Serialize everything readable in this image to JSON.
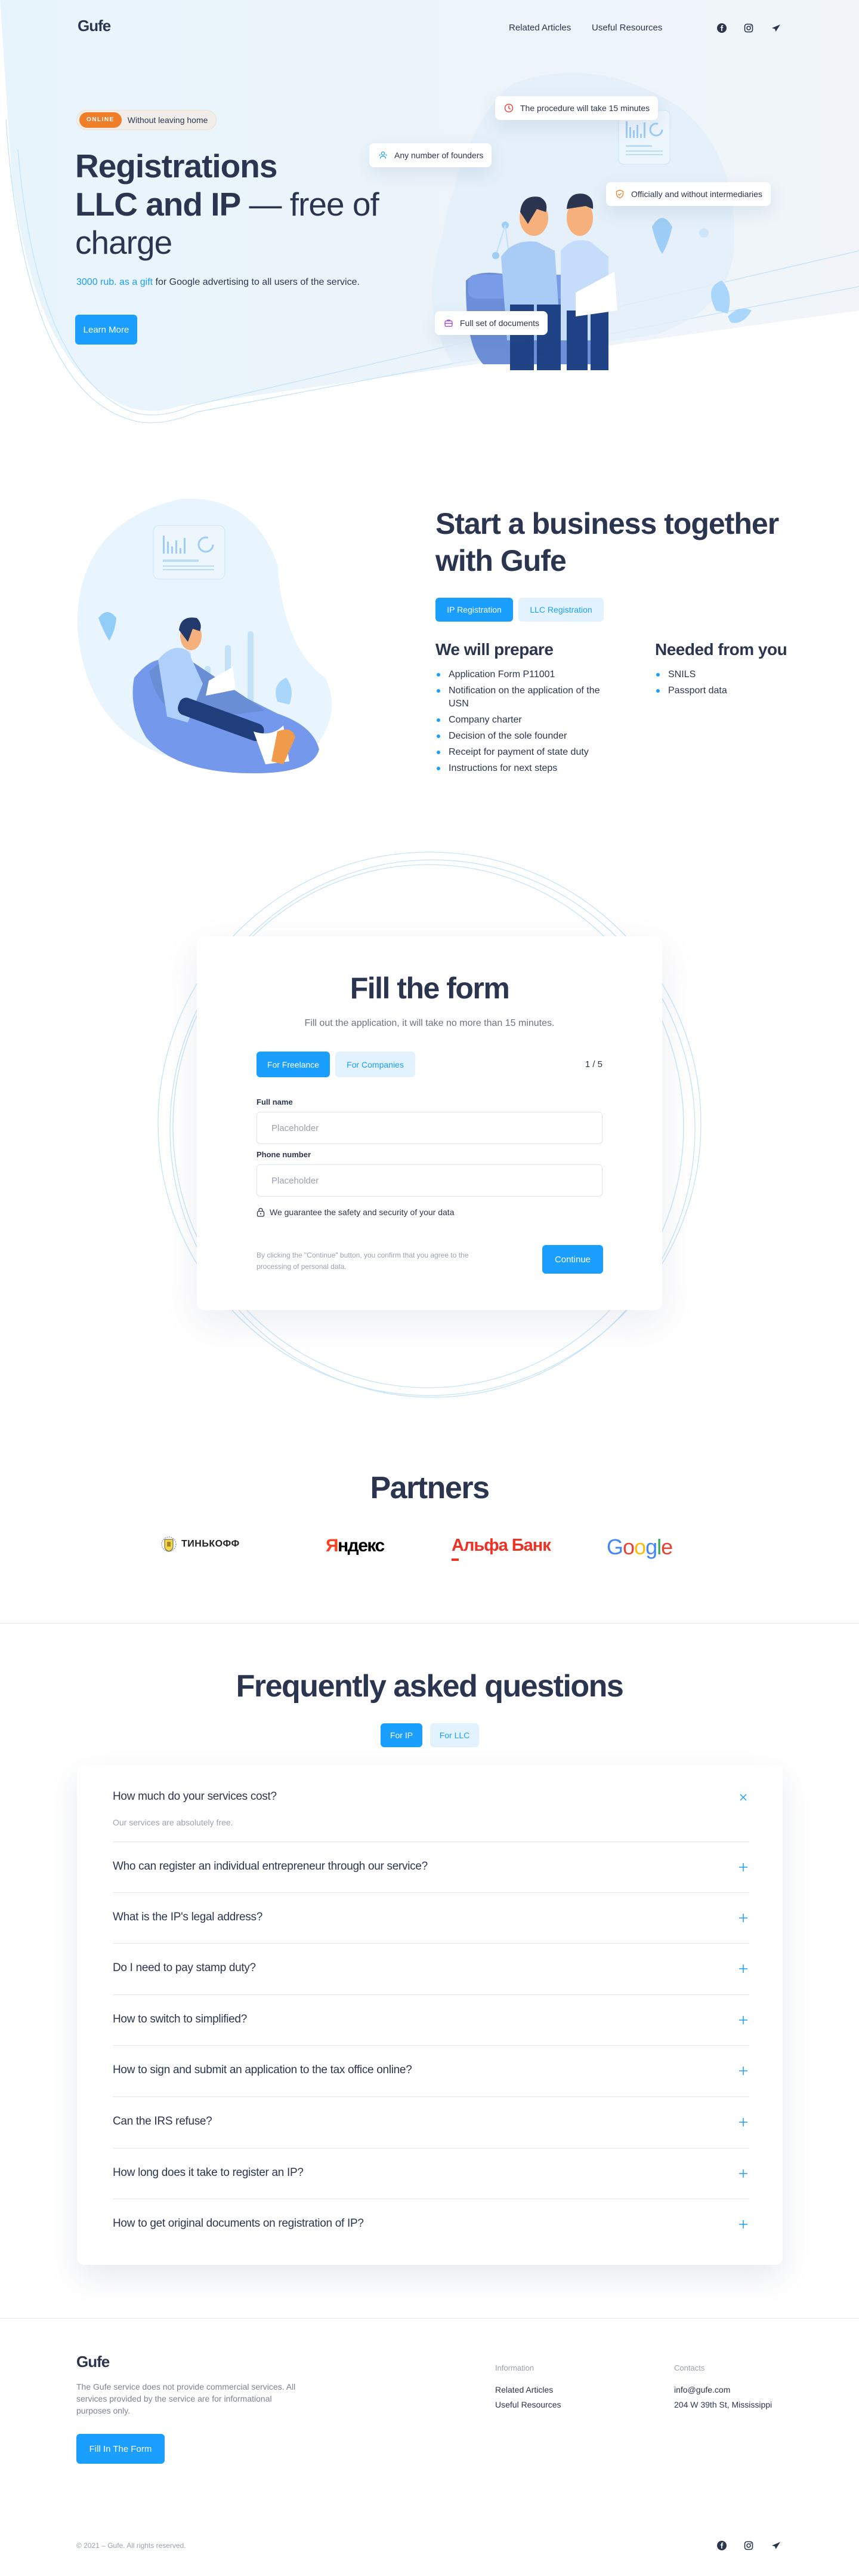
{
  "header": {
    "logo": "Gufe",
    "nav": [
      {
        "label": "Related Articles"
      },
      {
        "label": "Useful Resources"
      }
    ],
    "social": [
      "facebook-icon",
      "instagram-icon",
      "telegram-icon"
    ]
  },
  "hero": {
    "badge": "ONLINE",
    "badge_text": "Without leaving home",
    "title_bold_1": "Registrations",
    "title_bold_2": "LLC and IP",
    "title_light_2": " — free of",
    "title_light_3": "charge",
    "sub_accent": "3000 rub. as a gift",
    "sub_rest": " for Google advertising to all users of the service.",
    "cta": "Learn More",
    "features": [
      {
        "icon": "clock-icon",
        "label": "The procedure will take 15 minutes",
        "color": "#e8473f"
      },
      {
        "icon": "users-icon",
        "label": "Any number of founders",
        "color": "#1a9fff"
      },
      {
        "icon": "shield-check-icon",
        "label": "Officially and without intermediaries",
        "color": "#ef7d2a"
      },
      {
        "icon": "briefcase-icon",
        "label": "Full set of documents",
        "color": "#a23cd6"
      }
    ]
  },
  "business": {
    "title_light": "Start a business together",
    "title_bold": "with Gufe",
    "tabs": [
      {
        "label": "IP Registration",
        "active": true
      },
      {
        "label": "LLC Registration",
        "active": false
      }
    ],
    "prepare_heading": "We will prepare",
    "prepare_items": [
      "Application Form P11001",
      "Notification on the application of the USN",
      "Company charter",
      "Decision of the sole founder",
      "Receipt for payment of state duty",
      "Instructions for next steps"
    ],
    "needed_heading": "Needed from you",
    "needed_items": [
      "SNILS",
      "Passport data"
    ]
  },
  "form": {
    "title": "Fill the form",
    "subtitle": "Fill out the application, it will take no more than 15 minutes.",
    "tabs": [
      {
        "label": "For Freelance",
        "active": true
      },
      {
        "label": "For Companies",
        "active": false
      }
    ],
    "step": "1 / 5",
    "fields": [
      {
        "label": "Full name",
        "placeholder": "Placeholder",
        "value": ""
      },
      {
        "label": "Phone number",
        "placeholder": "Placeholder",
        "value": ""
      }
    ],
    "security_note": "We guarantee the safety and security of your data",
    "legal": "By clicking the \"Continue\" button, you confirm that you agree to the processing of personal data.",
    "submit": "Continue"
  },
  "partners": {
    "title": "Partners",
    "logos": [
      {
        "name": "ТИНЬКОФФ",
        "icon": "tinkoff-crest-icon"
      },
      {
        "name_first": "Я",
        "name_rest": "ндекс"
      },
      {
        "name": "Альфа Банк"
      },
      {
        "letters": [
          "G",
          "o",
          "o",
          "g",
          "l",
          "e"
        ],
        "colors": [
          "#4285f4",
          "#ea4335",
          "#fbbc05",
          "#4285f4",
          "#34a853",
          "#ea4335"
        ]
      }
    ]
  },
  "faq": {
    "title": "Frequently asked questions",
    "tabs": [
      {
        "label": "For IP",
        "active": true
      },
      {
        "label": "For LLC",
        "active": false
      }
    ],
    "items": [
      {
        "q": "How much do your services cost?",
        "a": "Our services are absolutely free.",
        "open": true
      },
      {
        "q": "Who can register an individual entrepreneur through our service?",
        "open": false
      },
      {
        "q": "What is the IP's legal address?",
        "open": false
      },
      {
        "q": "Do I need to pay stamp duty?",
        "open": false
      },
      {
        "q": "How to switch to simplified?",
        "open": false
      },
      {
        "q": "How to sign and submit an application to the tax office online?",
        "open": false
      },
      {
        "q": "Can the IRS refuse?",
        "open": false
      },
      {
        "q": "How long does it take to register an IP?",
        "open": false
      },
      {
        "q": "How to get original documents on registration of IP?",
        "open": false
      }
    ]
  },
  "footer": {
    "logo": "Gufe",
    "description": "The Gufe service does not provide commercial services. All services provided by the service are for informational purposes only.",
    "cta": "Fill In The Form",
    "info_heading": "Information",
    "info_links": [
      "Related Articles",
      "Useful Resources"
    ],
    "contacts_heading": "Contacts",
    "email": "info@gufe.com",
    "address": "204 W 39th St, Mississippi",
    "copyright": "© 2021 – Gufe. All rights reserved."
  },
  "colors": {
    "accent": "#1a9fff",
    "accent_soft": "#e2f2fe",
    "text": "#2b3550",
    "badge": "#ef7d2a"
  }
}
